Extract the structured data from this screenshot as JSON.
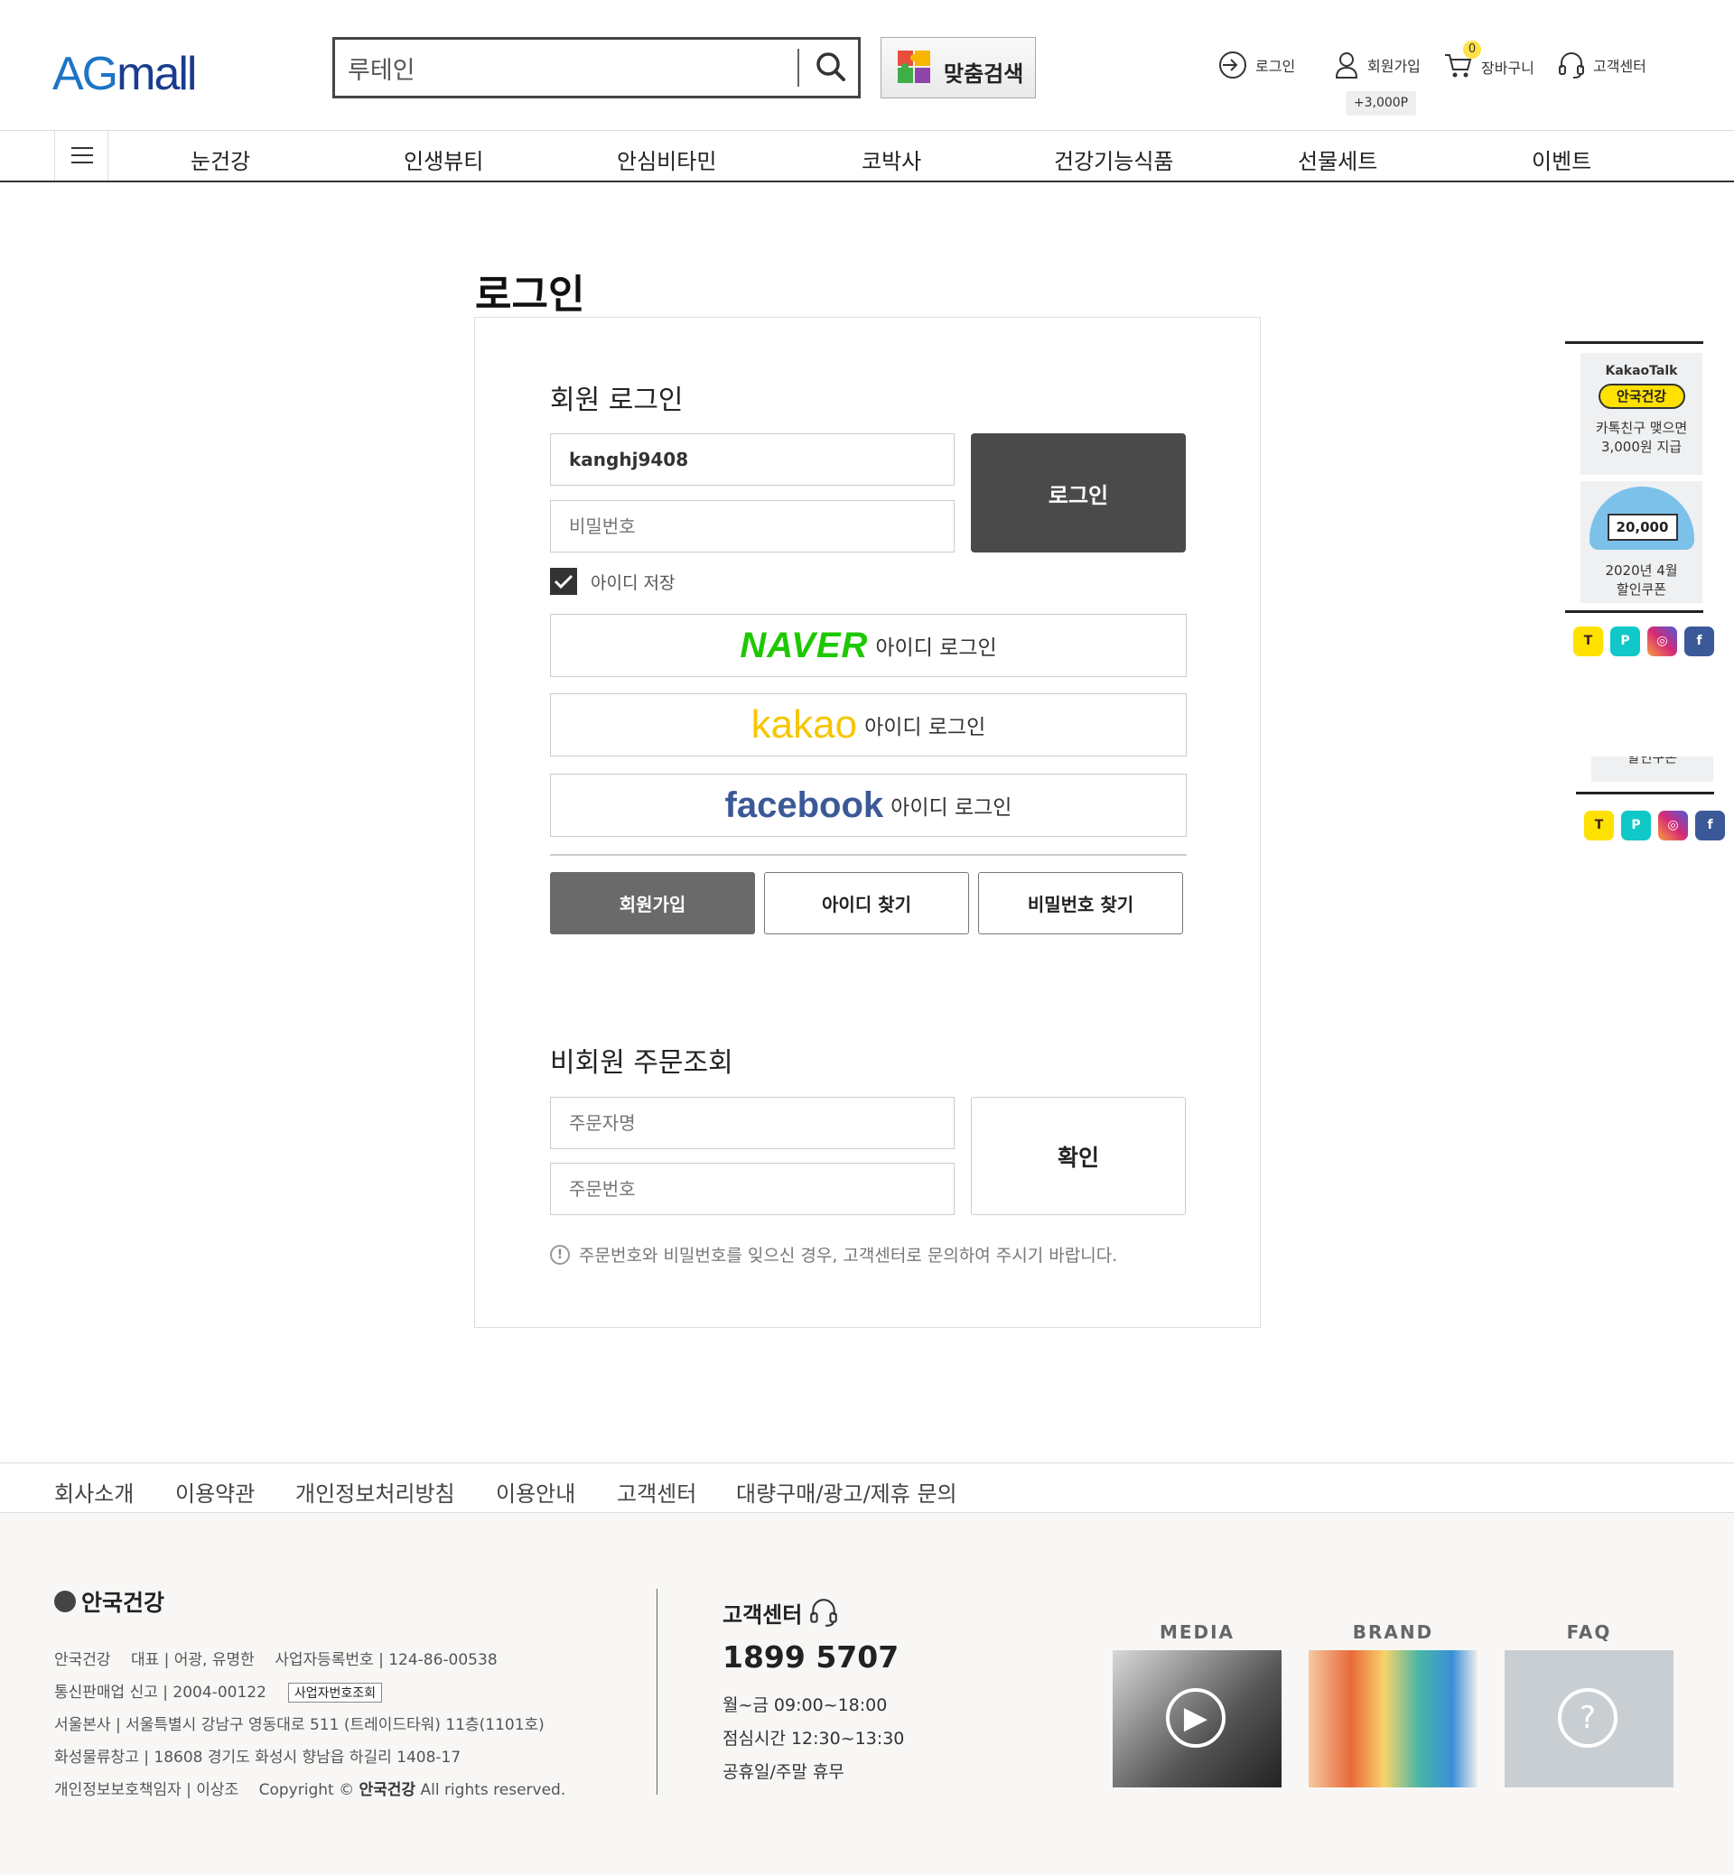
{
  "header": {
    "logo": {
      "ag": "AG",
      "mall": "mall"
    },
    "search": {
      "value": "루테인"
    },
    "custom_search_label": "맞춤검색",
    "util": {
      "login": "로그인",
      "join": "회원가입",
      "join_point": "+3,000P",
      "cart": "장바구니",
      "cart_count": "0",
      "cs": "고객센터"
    }
  },
  "nav": {
    "items": [
      "눈건강",
      "인생뷰티",
      "안심비타민",
      "코박사",
      "건강기능식품",
      "선물세트",
      "이벤트"
    ]
  },
  "login": {
    "page_title": "로그인",
    "member_title": "회원 로그인",
    "id_value": "kanghj9408",
    "password_placeholder": "비밀번호",
    "login_button": "로그인",
    "save_id_label": "아이디 저장",
    "naver_brand": "NAVER",
    "kakao_brand": "kakao",
    "facebook_brand": "facebook",
    "social_suffix": "아이디 로그인",
    "join_button": "회원가입",
    "find_id_button": "아이디 찾기",
    "find_pw_button": "비밀번호 찾기",
    "guest_title": "비회원 주문조회",
    "orderer_placeholder": "주문자명",
    "order_no_placeholder": "주문번호",
    "confirm_button": "확인",
    "notice": "주문번호와 비밀번호를 잊으신 경우, 고객센터로 문의하여 주시기 바랍니다."
  },
  "quick": {
    "kakao_card": {
      "title": "KakaoTalk",
      "brand": "안국건강",
      "line1": "카톡친구 맺으면",
      "line2": "3,000원 지급"
    },
    "coupon_card": {
      "amount": "20,000",
      "line1": "2020년 4월",
      "line2": "할인쿠폰"
    },
    "sns": [
      "talk-icon",
      "p-icon",
      "instagram-icon",
      "facebook-icon"
    ],
    "ghost_text": "할인쿠폰"
  },
  "footer": {
    "links": [
      "회사소개",
      "이용약관",
      "개인정보처리방침",
      "이용안내",
      "고객센터",
      "대량구매/광고/제휴 문의"
    ],
    "company_logo": "안국건강",
    "info1": "안국건강　 대표 | 어광, 유명한　 사업자등록번호 | 124-86-00538",
    "info2": "통신판매업 신고 | 2004-00122",
    "biz_button": "사업자번호조회",
    "info3": "서울본사 | 서울특별시 강남구 영동대로 511 (트레이드타워) 11층(1101호)",
    "info4": "화성물류창고 | 18608 경기도 화성시 향남읍 하길리 1408-17",
    "info5_a": "개인정보보호책임자 | 이상조　 Copyright © ",
    "info5_b": "안국건강",
    "info5_c": " All rights reserved.",
    "cs_title": "고객센터",
    "cs_phone": "1899 5707",
    "cs_hours": "월~금 09:00~18:00",
    "cs_lunch": "점심시간 12:30~13:30",
    "cs_holiday": "공휴일/주말 휴무",
    "media": "MEDIA",
    "brand": "BRAND",
    "faq": "FAQ"
  }
}
